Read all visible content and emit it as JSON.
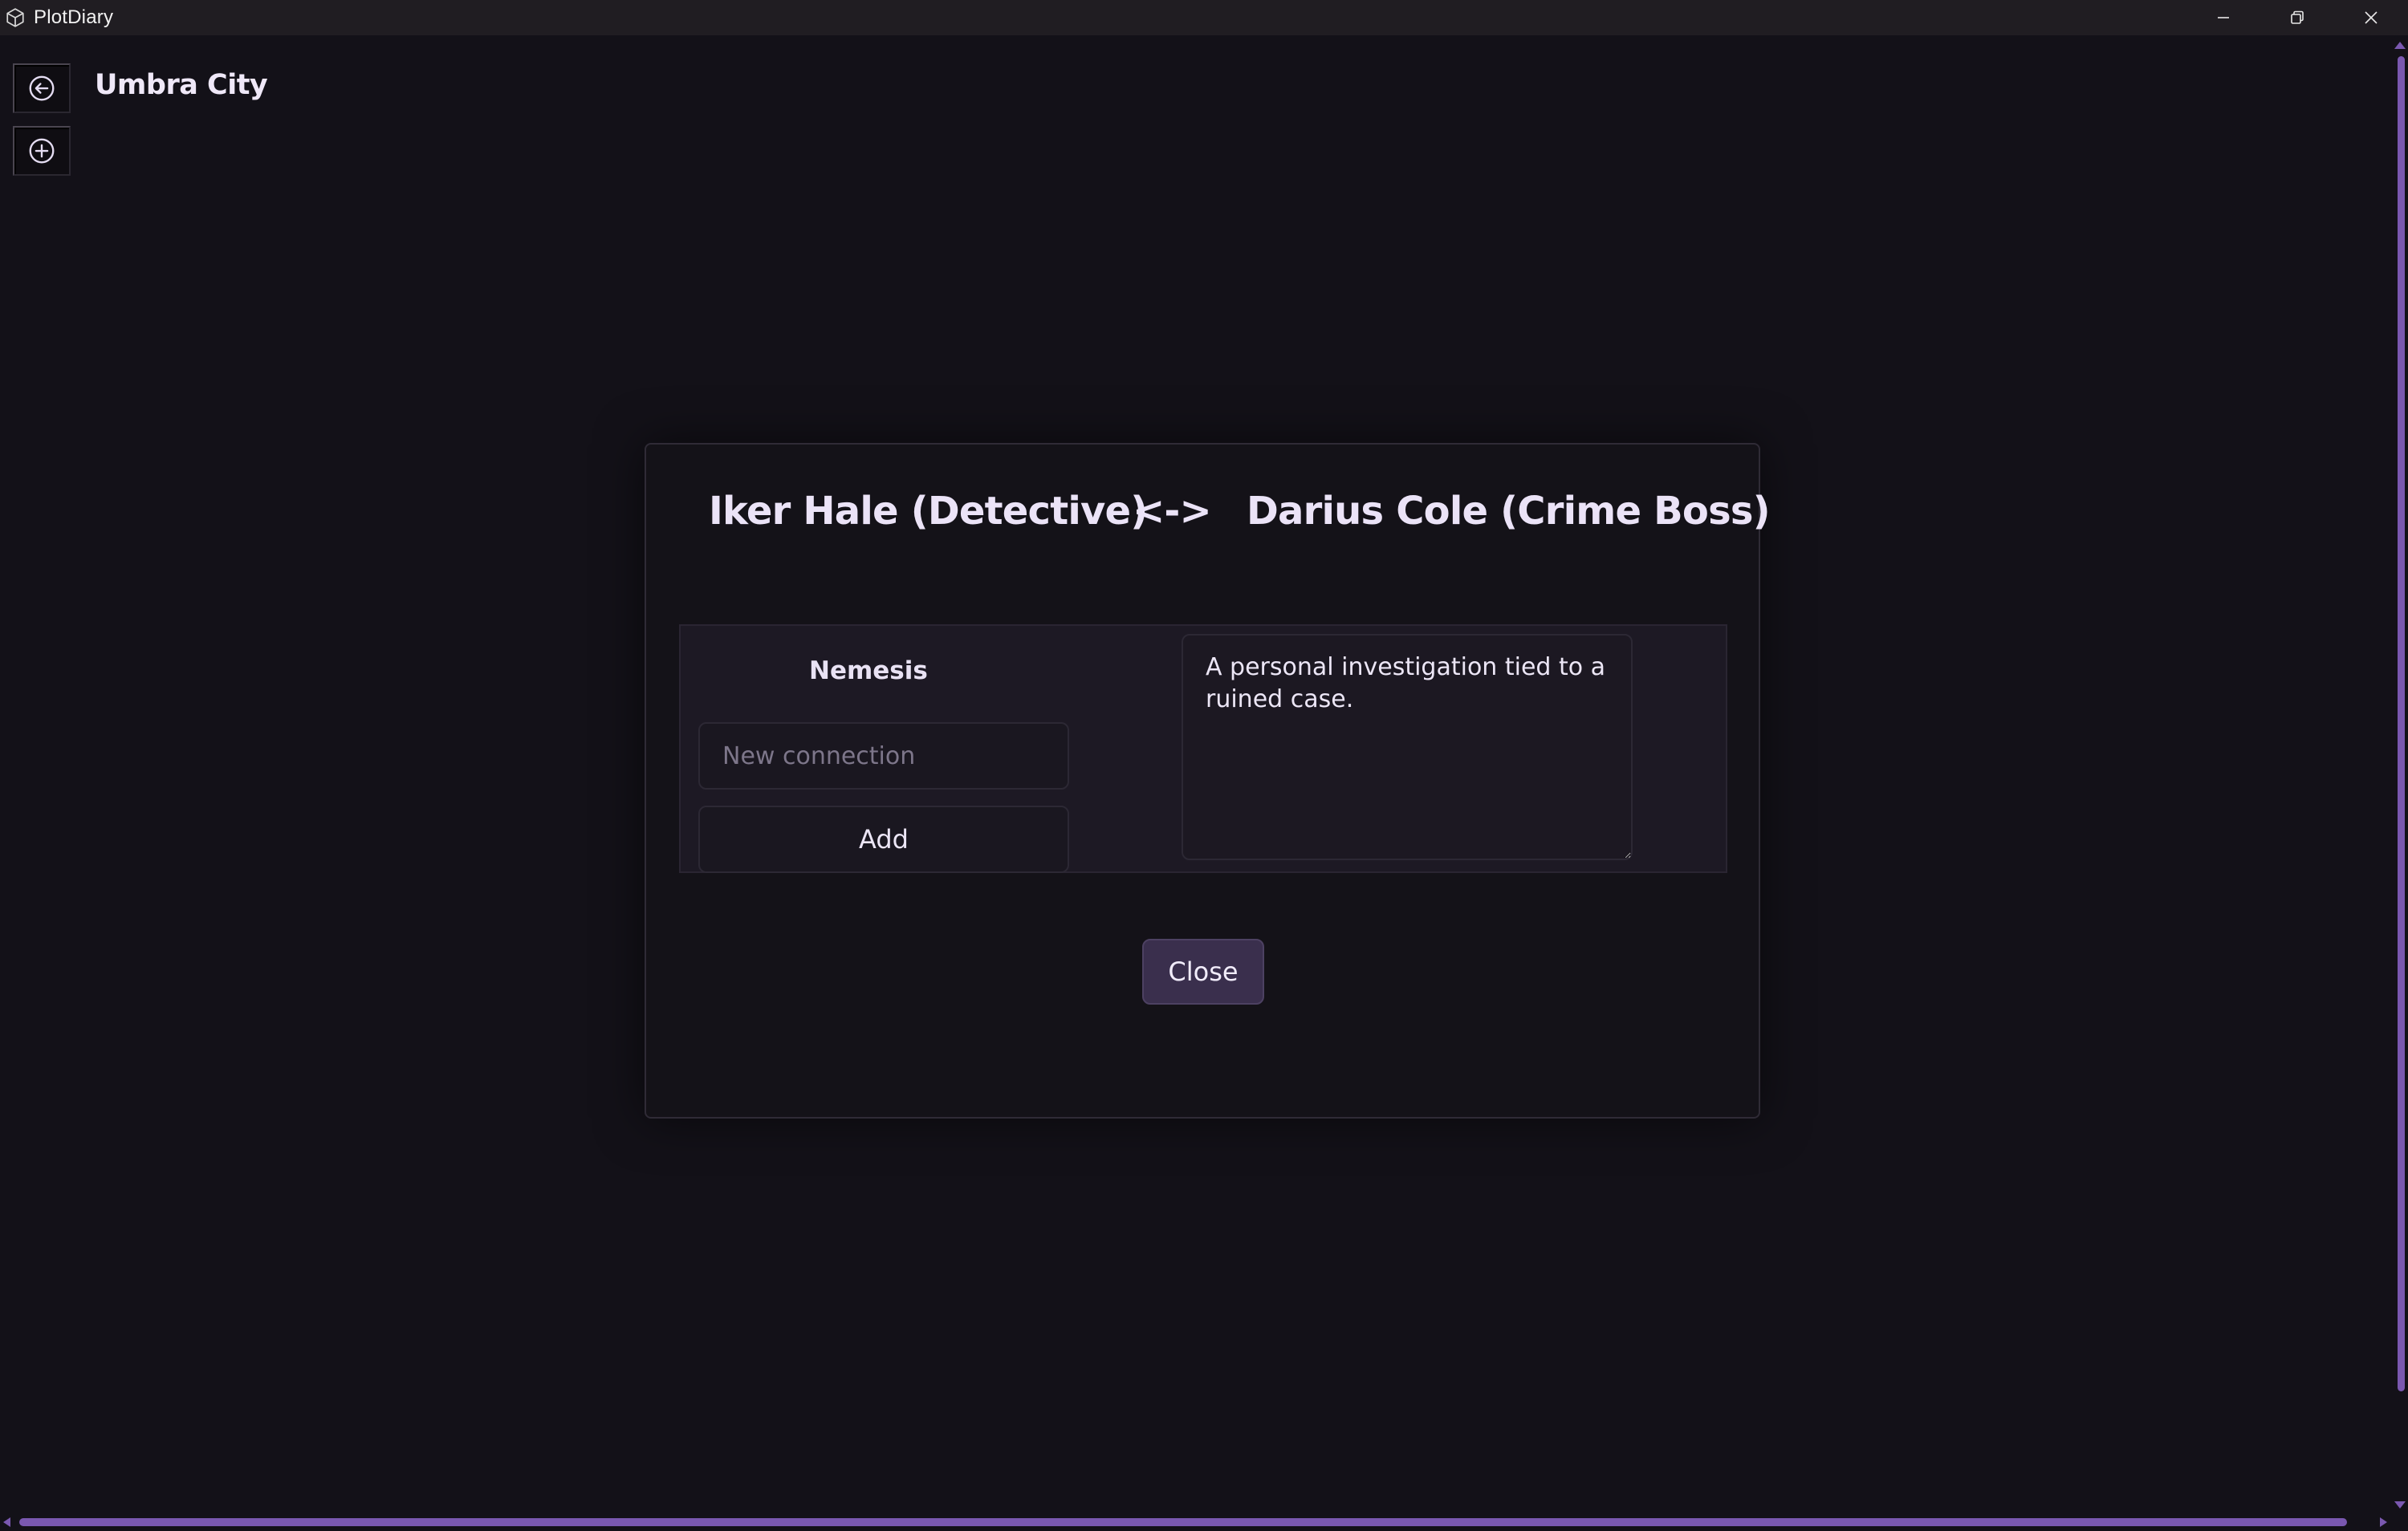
{
  "window": {
    "title": "PlotDiary",
    "controls": [
      "minimize",
      "restore",
      "close"
    ]
  },
  "nav": {
    "back_icon": "arrow-left-circle-icon",
    "add_icon": "plus-circle-icon",
    "project_title": "Umbra City"
  },
  "modal": {
    "character_a": "Iker Hale (Detective)",
    "separator": "<->",
    "character_b": "Darius Cole (Crime Boss)",
    "connection": {
      "type_label": "Nemesis",
      "input_placeholder": "New connection",
      "input_value": "",
      "add_label": "Add",
      "description": "A personal investigation tied to a ruined case."
    },
    "close_label": "Close"
  },
  "colors": {
    "background": "#131118",
    "titlebar": "#201d22",
    "accent": "#7a58b0",
    "close_button": "#3a2f4d",
    "text": "#ece6f6"
  }
}
